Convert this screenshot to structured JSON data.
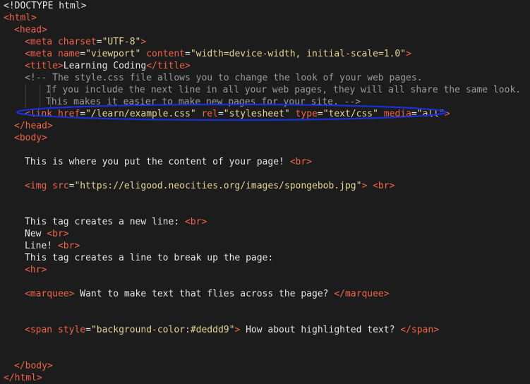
{
  "editor": {
    "language": "html",
    "highlight_color": "#1a2fd8",
    "lines": [
      [
        {
          "t": "text",
          "s": "<!DOCTYPE html>"
        }
      ],
      [
        {
          "t": "tag",
          "s": "<html>"
        }
      ],
      [
        {
          "t": "tag",
          "s": "<head>"
        }
      ],
      [
        {
          "t": "tag",
          "s": "<meta"
        },
        {
          "t": "text",
          "s": " "
        },
        {
          "t": "attr",
          "s": "charset"
        },
        {
          "t": "eq",
          "s": "="
        },
        {
          "t": "str",
          "s": "\"UTF-8\""
        },
        {
          "t": "tag",
          "s": ">"
        }
      ],
      [
        {
          "t": "tag",
          "s": "<meta"
        },
        {
          "t": "text",
          "s": " "
        },
        {
          "t": "attr",
          "s": "name"
        },
        {
          "t": "eq",
          "s": "="
        },
        {
          "t": "str",
          "s": "\"viewport\""
        },
        {
          "t": "text",
          "s": " "
        },
        {
          "t": "attr",
          "s": "content"
        },
        {
          "t": "eq",
          "s": "="
        },
        {
          "t": "str",
          "s": "\"width=device-width, initial-scale=1.0\""
        },
        {
          "t": "tag",
          "s": ">"
        }
      ],
      [
        {
          "t": "tag",
          "s": "<title>"
        },
        {
          "t": "text",
          "s": "Learning Coding"
        },
        {
          "t": "tag",
          "s": "</title>"
        }
      ],
      [
        {
          "t": "comment",
          "s": "<!-- The style.css file allows you to change the look of your web pages."
        }
      ],
      [
        {
          "t": "comment",
          "s": "If you include the next line in all your web pages, they will all share the same look."
        }
      ],
      [
        {
          "t": "comment",
          "s": "This makes it easier to make new pages for your site. -->"
        }
      ],
      [
        {
          "t": "tag",
          "s": "<link"
        },
        {
          "t": "text",
          "s": " "
        },
        {
          "t": "attr",
          "s": "href"
        },
        {
          "t": "eq",
          "s": "="
        },
        {
          "t": "str",
          "s": "\"/learn/example.css\""
        },
        {
          "t": "text",
          "s": " "
        },
        {
          "t": "attr",
          "s": "rel"
        },
        {
          "t": "eq",
          "s": "="
        },
        {
          "t": "str",
          "s": "\"stylesheet\""
        },
        {
          "t": "text",
          "s": " "
        },
        {
          "t": "attr",
          "s": "type"
        },
        {
          "t": "eq",
          "s": "="
        },
        {
          "t": "str",
          "s": "\"text/css\""
        },
        {
          "t": "text",
          "s": " "
        },
        {
          "t": "attr",
          "s": "media"
        },
        {
          "t": "eq",
          "s": "="
        },
        {
          "t": "str",
          "s": "\"all\""
        },
        {
          "t": "tag",
          "s": ">"
        }
      ],
      [
        {
          "t": "tag",
          "s": "</head>"
        }
      ],
      [
        {
          "t": "tag",
          "s": "<body>"
        }
      ],
      [],
      [
        {
          "t": "text",
          "s": "This is where you put the content of your page! "
        },
        {
          "t": "tag",
          "s": "<br>"
        }
      ],
      [],
      [
        {
          "t": "tag",
          "s": "<img"
        },
        {
          "t": "text",
          "s": " "
        },
        {
          "t": "attr",
          "s": "src"
        },
        {
          "t": "eq",
          "s": "="
        },
        {
          "t": "str",
          "s": "\"https://eligood.neocities.org/images/spongebob.jpg\""
        },
        {
          "t": "tag",
          "s": ">"
        },
        {
          "t": "text",
          "s": " "
        },
        {
          "t": "tag",
          "s": "<br>"
        }
      ],
      [],
      [],
      [
        {
          "t": "text",
          "s": "This tag creates a new line: "
        },
        {
          "t": "tag",
          "s": "<br>"
        }
      ],
      [
        {
          "t": "text",
          "s": "New "
        },
        {
          "t": "tag",
          "s": "<br>"
        }
      ],
      [
        {
          "t": "text",
          "s": "Line! "
        },
        {
          "t": "tag",
          "s": "<br>"
        }
      ],
      [
        {
          "t": "text",
          "s": "This tag creates a line to break up the page:"
        }
      ],
      [
        {
          "t": "tag",
          "s": "<hr>"
        }
      ],
      [],
      [
        {
          "t": "tag",
          "s": "<marquee>"
        },
        {
          "t": "text",
          "s": " Want to make text that flies across the page? "
        },
        {
          "t": "tag",
          "s": "</marquee>"
        }
      ],
      [],
      [],
      [
        {
          "t": "tag",
          "s": "<span"
        },
        {
          "t": "text",
          "s": " "
        },
        {
          "t": "attr",
          "s": "style"
        },
        {
          "t": "eq",
          "s": "="
        },
        {
          "t": "str",
          "s": "\"background-color:#deddd9\""
        },
        {
          "t": "tag",
          "s": ">"
        },
        {
          "t": "text",
          "s": " How about highlighted text? "
        },
        {
          "t": "tag",
          "s": "</span>"
        }
      ],
      [],
      [],
      [
        {
          "t": "tag",
          "s": "</body>"
        }
      ],
      [
        {
          "t": "tag",
          "s": "</html>"
        }
      ]
    ]
  }
}
